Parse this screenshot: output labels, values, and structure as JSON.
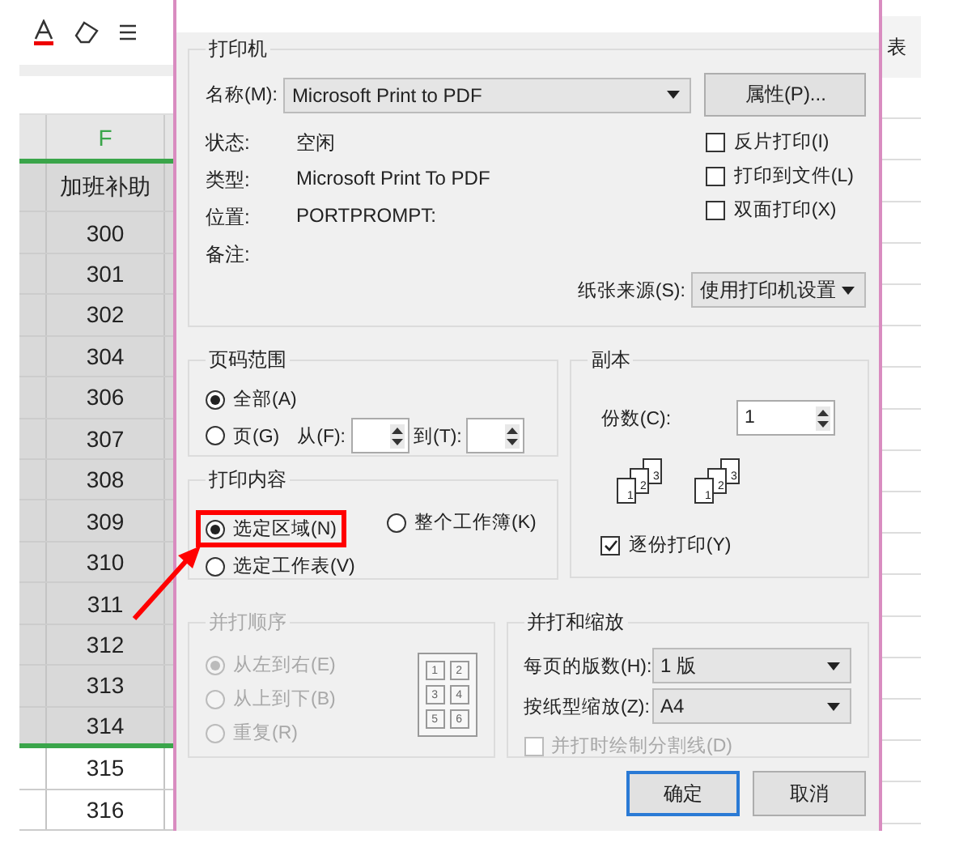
{
  "sheet": {
    "column_header": "F",
    "rows": [
      {
        "value": "加班补助",
        "selected": true
      },
      {
        "value": "300",
        "selected": true
      },
      {
        "value": "301",
        "selected": true
      },
      {
        "value": "302",
        "selected": true
      },
      {
        "value": "304",
        "selected": true
      },
      {
        "value": "306",
        "selected": true
      },
      {
        "value": "307",
        "selected": true
      },
      {
        "value": "308",
        "selected": true
      },
      {
        "value": "309",
        "selected": true
      },
      {
        "value": "310",
        "selected": true
      },
      {
        "value": "311",
        "selected": true
      },
      {
        "value": "312",
        "selected": true
      },
      {
        "value": "313",
        "selected": true
      },
      {
        "value": "314",
        "selected": true
      },
      {
        "value": "315",
        "selected": false
      },
      {
        "value": "316",
        "selected": false
      }
    ]
  },
  "right_strip": {
    "label": "表"
  },
  "dialog": {
    "printer": {
      "title": "打印机",
      "name_label": "名称(M):",
      "name_value": "Microsoft Print to PDF",
      "properties_button": "属性(P)...",
      "info": [
        {
          "label": "状态:",
          "value": "空闲"
        },
        {
          "label": "类型:",
          "value": "Microsoft Print To PDF"
        },
        {
          "label": "位置:",
          "value": "PORTPROMPT:"
        },
        {
          "label": "备注:"
        }
      ],
      "options": [
        {
          "label": "反片打印(I)",
          "checked": false
        },
        {
          "label": "打印到文件(L)",
          "checked": false
        },
        {
          "label": "双面打印(X)",
          "checked": false
        }
      ],
      "source_label": "纸张来源(S):",
      "source_value": "使用打印机设置"
    },
    "page_range": {
      "title": "页码范围",
      "options": [
        {
          "label": "全部(A)",
          "selected": true
        },
        {
          "label": "页(G)",
          "selected": false
        }
      ],
      "from_label": "从(F):",
      "to_label": "到(T):"
    },
    "copies": {
      "title": "副本",
      "count_label": "份数(C):",
      "count": "1",
      "stacks": [
        {
          "pages": [
            "1",
            "2",
            "3"
          ]
        },
        {
          "pages": [
            "1",
            "2",
            "3"
          ]
        }
      ],
      "collate": {
        "label": "逐份打印(Y)",
        "checked": true
      }
    },
    "print_content": {
      "title": "打印内容",
      "options": [
        {
          "label": "选定区域(N)",
          "selected": true,
          "highlighted": true
        },
        {
          "label": "整个工作簿(K)",
          "selected": false,
          "highlighted": false
        },
        {
          "label": "选定工作表(V)",
          "selected": false,
          "highlighted": false
        }
      ]
    },
    "order": {
      "title": "并打顺序",
      "disabled": true,
      "options": [
        {
          "label": "从左到右(E)",
          "selected": true
        },
        {
          "label": "从上到下(B)",
          "selected": false
        },
        {
          "label": "重复(R)",
          "selected": false
        }
      ],
      "grid_pages": [
        "1",
        "2",
        "3",
        "4",
        "5",
        "6"
      ]
    },
    "scaling": {
      "title": "并打和缩放",
      "rows": [
        {
          "label": "每页的版数(H):",
          "value": "1 版"
        },
        {
          "label": "按纸型缩放(Z):",
          "value": "A4"
        }
      ],
      "divider_option": {
        "label": "并打时绘制分割线(D)",
        "checked": false,
        "disabled": true
      }
    },
    "buttons": [
      {
        "label": "确定",
        "default": true
      },
      {
        "label": "取消",
        "default": false
      }
    ]
  }
}
